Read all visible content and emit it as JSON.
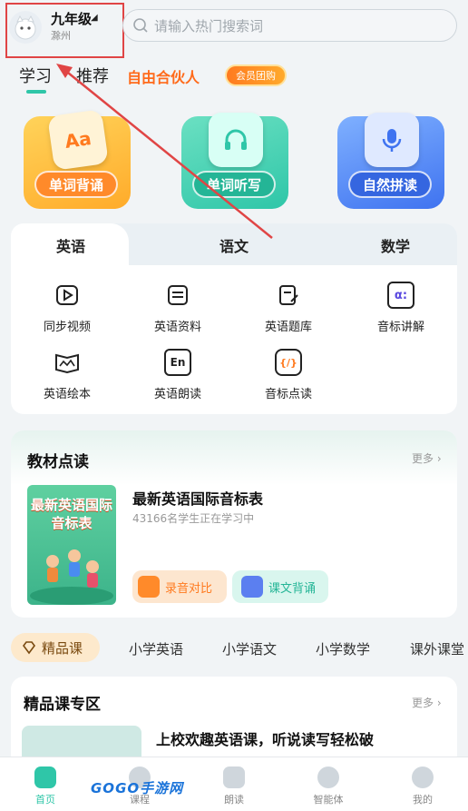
{
  "header": {
    "grade": "九年级",
    "city": "滁州",
    "search_placeholder": "请输入热门搜索词"
  },
  "top_tabs": {
    "study": "学习",
    "recommend": "推荐",
    "partner": "自由合伙人",
    "vip_group": "会员团购"
  },
  "features": [
    {
      "label": "单词背诵",
      "icon": "Aa"
    },
    {
      "label": "单词听写"
    },
    {
      "label": "自然拼读"
    }
  ],
  "subjects": {
    "tabs": [
      "英语",
      "语文",
      "数学"
    ],
    "tools": [
      {
        "label": "同步视频"
      },
      {
        "label": "英语资料"
      },
      {
        "label": "英语题库"
      },
      {
        "label": "音标讲解"
      },
      {
        "label": "英语绘本"
      },
      {
        "label": "英语朗读"
      },
      {
        "label": "音标点读"
      }
    ],
    "tool_icon_en": "En",
    "tool_icon_alpha": "α:",
    "tool_icon_slash": "{/}"
  },
  "textbook": {
    "title": "教材点读",
    "more": "更多 ›",
    "cover_title": "最新英语国际音标表",
    "book_title": "最新英语国际音标表",
    "learners": "43166名学生正在学习中",
    "btn_record": "录音对比",
    "btn_recite": "课文背诵"
  },
  "course_tabs": [
    "精品课",
    "小学英语",
    "小学语文",
    "小学数学",
    "课外课堂"
  ],
  "premium": {
    "title": "精品课专区",
    "more": "更多 ›",
    "course_title": "上校欢趣英语课，听说读写轻松破"
  },
  "bottom_nav": [
    {
      "label": "首页",
      "active": true
    },
    {
      "label": "课程"
    },
    {
      "label": "朗读"
    },
    {
      "label": "智能体"
    },
    {
      "label": "我的"
    }
  ],
  "watermark": "GOGO手游网",
  "colors": {
    "accent": "#2fc6a8",
    "orange": "#ff6a1a",
    "annotation": "#e04545"
  }
}
